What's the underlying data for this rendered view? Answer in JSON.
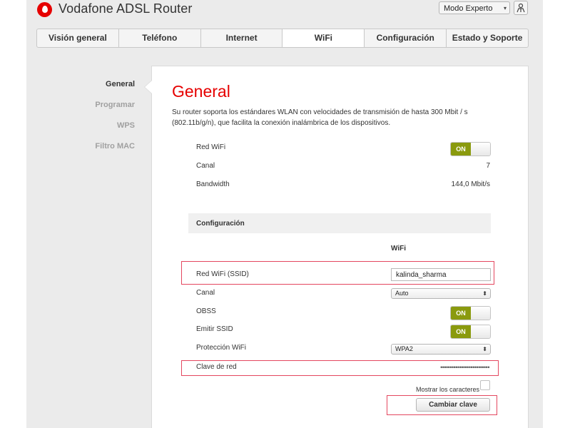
{
  "header": {
    "app_title": "Vodafone ADSL Router",
    "mode_select": "Modo Experto",
    "brand_color": "#e60000"
  },
  "tabs": [
    {
      "label": "Visión general"
    },
    {
      "label": "Teléfono"
    },
    {
      "label": "Internet"
    },
    {
      "label": "WiFi",
      "active": true
    },
    {
      "label": "Configuración"
    },
    {
      "label": "Estado y Soporte"
    }
  ],
  "sidebar": {
    "items": [
      {
        "label": "General",
        "active": true
      },
      {
        "label": "Programar"
      },
      {
        "label": "WPS"
      },
      {
        "label": "Filtro MAC"
      }
    ]
  },
  "main": {
    "title": "General",
    "description": "Su router soporta los estándares WLAN con velocidades de transmisión de hasta 300 Mbit / s (802.11b/g/n), que facilita la conexión inalámbrica de los dispositivos.",
    "status": {
      "wifi_label": "Red WiFi",
      "wifi_toggle": "ON",
      "channel_label": "Canal",
      "channel_value": "7",
      "bandwidth_label": "Bandwidth",
      "bandwidth_value": "144,0 Mbit/s"
    },
    "config": {
      "section_title": "Configuración",
      "column_header": "WiFi",
      "ssid_label": "Red WiFi (SSID)",
      "ssid_value": "kalinda_sharma",
      "channel_label": "Canal",
      "channel_value": "Auto",
      "obss_label": "OBSS",
      "obss_toggle": "ON",
      "emit_ssid_label": "Emitir SSID",
      "emit_ssid_toggle": "ON",
      "protection_label": "Protección WiFi",
      "protection_value": "WPA2",
      "key_label": "Clave de red",
      "key_value": "••••••••••••••••••••••••••",
      "show_chars_label": "Mostrar los caracteres",
      "change_key_button": "Cambiar clave"
    }
  },
  "colors": {
    "toggle_on": "#8a9a0e",
    "highlight": "#e4475f"
  }
}
